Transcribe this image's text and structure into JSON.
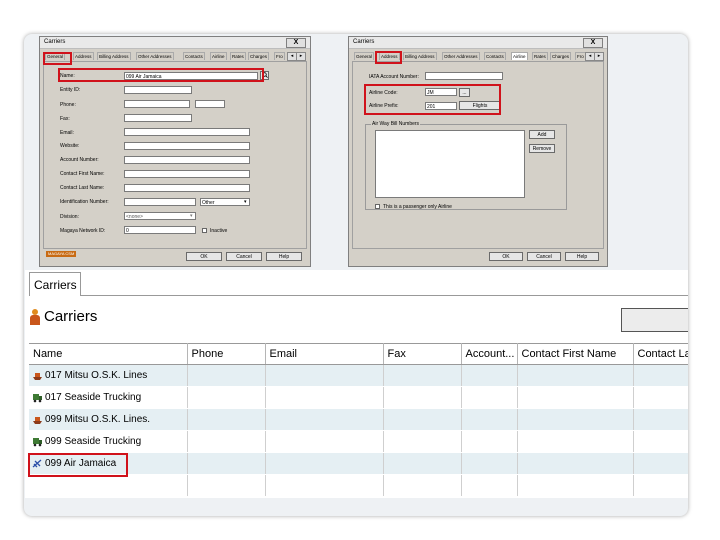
{
  "left_dialog": {
    "title": "Carriers",
    "close_label": "X",
    "tabs": [
      "General",
      "Address",
      "Billing Address",
      "Other Addresses",
      "Contacts",
      "Airline",
      "Rates",
      "Charges",
      "Fro"
    ],
    "nav_prev": "◂",
    "nav_next": "▸",
    "fields": {
      "name_label": "Name:",
      "name_value": "099 Air Jamaica",
      "entity_id_label": "Entity ID:",
      "phone_label": "Phone:",
      "fax_label": "Fax:",
      "email_label": "Email:",
      "website_label": "Website:",
      "account_number_label": "Account Number:",
      "contact_first_name_label": "Contact First Name:",
      "contact_last_name_label": "Contact Last Name:",
      "identification_number_label": "Identification Number:",
      "identification_type_value": "Other",
      "division_label": "Division:",
      "division_value": "<none>",
      "magaya_network_id_label": "Magaya Network ID:",
      "magaya_network_id_value": "0",
      "inactive_label": "Inactive"
    },
    "logo_text": "MAGAYA CSM",
    "buttons": {
      "ok": "OK",
      "cancel": "Cancel",
      "help": "Help"
    }
  },
  "right_dialog": {
    "title": "Carriers",
    "close_label": "X",
    "tabs": [
      "General",
      "Address",
      "Billing Address",
      "Other Addresses",
      "Contacts",
      "Airline",
      "Rates",
      "Charges",
      "Fro"
    ],
    "nav_prev": "◂",
    "nav_next": "▸",
    "fields": {
      "iata_account_label": "IATA Account Number:",
      "airline_code_label": "Airline Code:",
      "airline_code_value": "JM",
      "airline_prefix_label": "Airline Prefix:",
      "airline_prefix_value": "201",
      "ellipsis_label": "...",
      "flights_button": "Flights",
      "awb_group_label": "Air Way Bill Numbers",
      "add_button": "Add",
      "remove_button": "Remove",
      "passenger_only_label": "This is a passenger only Airline"
    },
    "buttons": {
      "ok": "OK",
      "cancel": "Cancel",
      "help": "Help"
    }
  },
  "list_panel": {
    "tab_label": "Carriers",
    "header_title": "Carriers",
    "columns": [
      "Name",
      "Phone",
      "Email",
      "Fax",
      "Account...",
      "Contact First Name",
      "Contact Las"
    ],
    "rows": [
      {
        "name": "017 Mitsu O.S.K. Lines",
        "icon": "ship-icon"
      },
      {
        "name": "017 Seaside Trucking",
        "icon": "truck-icon"
      },
      {
        "name": "099 Mitsu O.S.K. Lines.",
        "icon": "ship-icon"
      },
      {
        "name": "099 Seaside Trucking",
        "icon": "truck-icon"
      },
      {
        "name": "099 Air Jamaica",
        "icon": "airplane-icon"
      },
      {
        "name": "",
        "icon": ""
      }
    ]
  },
  "colors": {
    "highlight": "#d0121b",
    "dialog_bg": "#d4d0c8",
    "row_alt": "#e5eff3"
  }
}
